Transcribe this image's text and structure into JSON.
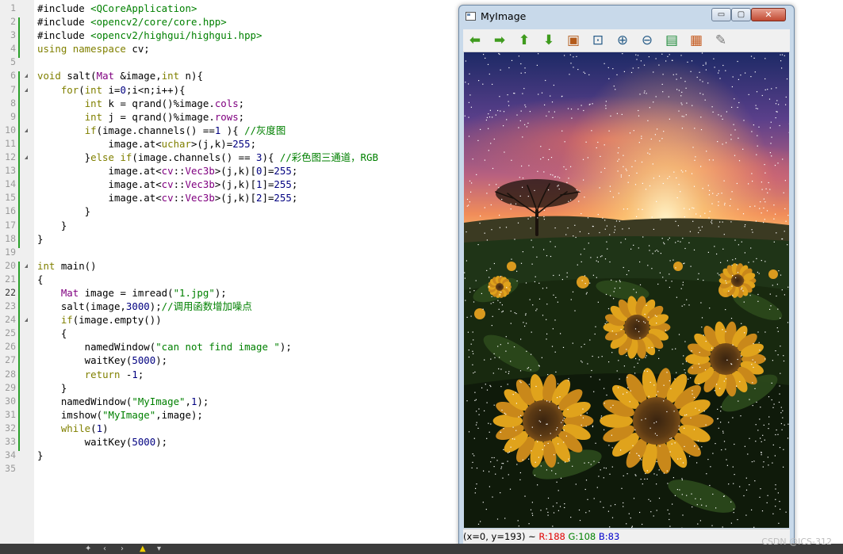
{
  "editor": {
    "current_line": 22,
    "lines": [
      [
        [
          "pl",
          "#include "
        ],
        [
          "st",
          "<QCoreApplication>"
        ]
      ],
      [
        [
          "pl",
          "#include "
        ],
        [
          "st",
          "<opencv2/core/core.hpp>"
        ]
      ],
      [
        [
          "pl",
          "#include "
        ],
        [
          "st",
          "<opencv2/highgui/highgui.hpp>"
        ]
      ],
      [
        [
          "kw",
          "using namespace "
        ],
        [
          "pl",
          "cv;"
        ]
      ],
      [],
      [
        [
          "kw",
          "void "
        ],
        [
          "pl",
          "salt("
        ],
        [
          "ty",
          "Mat "
        ],
        [
          "pl",
          "&image,"
        ],
        [
          "kw",
          "int "
        ],
        [
          "pl",
          "n){"
        ]
      ],
      [
        [
          "pl",
          "    "
        ],
        [
          "kw",
          "for"
        ],
        [
          "pl",
          "("
        ],
        [
          "kw",
          "int "
        ],
        [
          "pl",
          "i="
        ],
        [
          "nm",
          "0"
        ],
        [
          "pl",
          ";i<n;i++){"
        ]
      ],
      [
        [
          "pl",
          "        "
        ],
        [
          "kw",
          "int "
        ],
        [
          "pl",
          "k = qrand()%image."
        ],
        [
          "ty",
          "cols"
        ],
        [
          "pl",
          ";"
        ]
      ],
      [
        [
          "pl",
          "        "
        ],
        [
          "kw",
          "int "
        ],
        [
          "pl",
          "j = qrand()%image."
        ],
        [
          "ty",
          "rows"
        ],
        [
          "pl",
          ";"
        ]
      ],
      [
        [
          "pl",
          "        "
        ],
        [
          "kw",
          "if"
        ],
        [
          "pl",
          "(image.channels() =="
        ],
        [
          "nm",
          "1"
        ],
        [
          "pl",
          " ){ "
        ],
        [
          "cm",
          "//灰度图"
        ]
      ],
      [
        [
          "pl",
          "            image.at<"
        ],
        [
          "kw",
          "uchar"
        ],
        [
          "pl",
          ">(j,k)="
        ],
        [
          "nm",
          "255"
        ],
        [
          "pl",
          ";"
        ]
      ],
      [
        [
          "pl",
          "        }"
        ],
        [
          "kw",
          "else if"
        ],
        [
          "pl",
          "(image.channels() == "
        ],
        [
          "nm",
          "3"
        ],
        [
          "pl",
          "){ "
        ],
        [
          "cm",
          "//彩色图三通道，RGB"
        ]
      ],
      [
        [
          "pl",
          "            image.at<"
        ],
        [
          "ty",
          "cv"
        ],
        [
          "pl",
          "::"
        ],
        [
          "ty",
          "Vec3b"
        ],
        [
          "pl",
          ">(j,k)["
        ],
        [
          "nm",
          "0"
        ],
        [
          "pl",
          "]="
        ],
        [
          "nm",
          "255"
        ],
        [
          "pl",
          ";"
        ]
      ],
      [
        [
          "pl",
          "            image.at<"
        ],
        [
          "ty",
          "cv"
        ],
        [
          "pl",
          "::"
        ],
        [
          "ty",
          "Vec3b"
        ],
        [
          "pl",
          ">(j,k)["
        ],
        [
          "nm",
          "1"
        ],
        [
          "pl",
          "]="
        ],
        [
          "nm",
          "255"
        ],
        [
          "pl",
          ";"
        ]
      ],
      [
        [
          "pl",
          "            image.at<"
        ],
        [
          "ty",
          "cv"
        ],
        [
          "pl",
          "::"
        ],
        [
          "ty",
          "Vec3b"
        ],
        [
          "pl",
          ">(j,k)["
        ],
        [
          "nm",
          "2"
        ],
        [
          "pl",
          "]="
        ],
        [
          "nm",
          "255"
        ],
        [
          "pl",
          ";"
        ]
      ],
      [
        [
          "pl",
          "        }"
        ]
      ],
      [
        [
          "pl",
          "    }"
        ]
      ],
      [
        [
          "pl",
          "}"
        ]
      ],
      [],
      [
        [
          "kw",
          "int "
        ],
        [
          "pl",
          "main()"
        ]
      ],
      [
        [
          "pl",
          "{"
        ]
      ],
      [
        [
          "pl",
          "    "
        ],
        [
          "ty",
          "Mat "
        ],
        [
          "pl",
          "image = imread("
        ],
        [
          "st",
          "\"1.jpg\""
        ],
        [
          "pl",
          ");"
        ]
      ],
      [
        [
          "pl",
          "    salt(image,"
        ],
        [
          "nm",
          "3000"
        ],
        [
          "pl",
          ");"
        ],
        [
          "cm",
          "//调用函数增加噪点"
        ]
      ],
      [
        [
          "pl",
          "    "
        ],
        [
          "kw",
          "if"
        ],
        [
          "pl",
          "(image.empty())"
        ]
      ],
      [
        [
          "pl",
          "    {"
        ]
      ],
      [
        [
          "pl",
          "        namedWindow("
        ],
        [
          "st",
          "\"can not find image \""
        ],
        [
          "pl",
          ");"
        ]
      ],
      [
        [
          "pl",
          "        waitKey("
        ],
        [
          "nm",
          "5000"
        ],
        [
          "pl",
          ");"
        ]
      ],
      [
        [
          "pl",
          "        "
        ],
        [
          "kw",
          "return "
        ],
        [
          "pl",
          "-"
        ],
        [
          "nm",
          "1"
        ],
        [
          "pl",
          ";"
        ]
      ],
      [
        [
          "pl",
          "    }"
        ]
      ],
      [
        [
          "pl",
          "    namedWindow("
        ],
        [
          "st",
          "\"MyImage\""
        ],
        [
          "pl",
          ","
        ],
        [
          "nm",
          "1"
        ],
        [
          "pl",
          ");"
        ]
      ],
      [
        [
          "pl",
          "    imshow("
        ],
        [
          "st",
          "\"MyImage\""
        ],
        [
          "pl",
          ",image);"
        ]
      ],
      [
        [
          "pl",
          "    "
        ],
        [
          "kw",
          "while"
        ],
        [
          "pl",
          "("
        ],
        [
          "nm",
          "1"
        ],
        [
          "pl",
          ")"
        ]
      ],
      [
        [
          "pl",
          "        waitKey("
        ],
        [
          "nm",
          "5000"
        ],
        [
          "pl",
          ");"
        ]
      ],
      [
        [
          "pl",
          "}"
        ]
      ],
      []
    ]
  },
  "window": {
    "title": "MyImage",
    "buttons": {
      "minimize": "▭",
      "maximize": "▢",
      "close": "✕"
    },
    "toolbar": [
      {
        "name": "pan-left",
        "glyph": "⬅",
        "icon": "arrow-left-icon",
        "cls": "arrow"
      },
      {
        "name": "pan-right",
        "glyph": "➡",
        "icon": "arrow-right-icon",
        "cls": "arrow"
      },
      {
        "name": "pan-up",
        "glyph": "⬆",
        "icon": "arrow-up-icon",
        "cls": "arrow"
      },
      {
        "name": "pan-down",
        "glyph": "⬇",
        "icon": "arrow-down-icon",
        "cls": "arrow"
      },
      {
        "name": "zoom-fit",
        "glyph": "▣",
        "icon": "image-icon",
        "cls": "img"
      },
      {
        "name": "zoom-region",
        "glyph": "⊡",
        "icon": "zoom-region-icon",
        "cls": "zoom"
      },
      {
        "name": "zoom-in",
        "glyph": "⊕",
        "icon": "zoom-in-icon",
        "cls": "zoom"
      },
      {
        "name": "zoom-out",
        "glyph": "⊖",
        "icon": "zoom-out-icon",
        "cls": "zoom"
      },
      {
        "name": "save",
        "glyph": "▤",
        "icon": "save-icon",
        "cls": "save"
      },
      {
        "name": "copy",
        "glyph": "▦",
        "icon": "clipboard-icon",
        "cls": "clip"
      },
      {
        "name": "properties",
        "glyph": "✎",
        "icon": "brush-icon",
        "cls": "brush"
      }
    ],
    "status": {
      "coords": "(x=0, y=193) ~ ",
      "r": "R:188",
      "g": "G:108",
      "b": "B:83"
    }
  },
  "watermark": "CSDN @ICS-312",
  "colors": {
    "r_label": "#e00000",
    "g_label": "#008000",
    "b_label": "#0000cc"
  }
}
